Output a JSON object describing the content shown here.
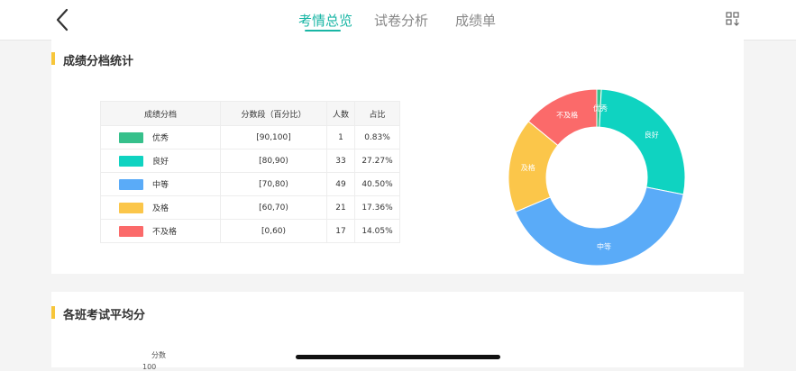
{
  "header": {
    "tabs": [
      {
        "label": "考情总览",
        "active": true
      },
      {
        "label": "试卷分析",
        "active": false
      },
      {
        "label": "成绩单",
        "active": false
      }
    ],
    "accent_color": "#19b6a5"
  },
  "grade_section": {
    "title": "成绩分档统计",
    "table": {
      "headers": [
        "成绩分档",
        "分数段（百分比）",
        "人数",
        "占比"
      ],
      "rows": [
        {
          "level": "优秀",
          "range": "[90,100]",
          "count": "1",
          "ratio": "0.83%",
          "color": "#36c08b"
        },
        {
          "level": "良好",
          "range": "[80,90)",
          "count": "33",
          "ratio": "27.27%",
          "color": "#0fd3c1"
        },
        {
          "level": "中等",
          "range": "[70,80)",
          "count": "49",
          "ratio": "40.50%",
          "color": "#5aabf8"
        },
        {
          "level": "及格",
          "range": "[60,70)",
          "count": "21",
          "ratio": "17.36%",
          "color": "#fbc64a"
        },
        {
          "level": "不及格",
          "range": "[0,60)",
          "count": "17",
          "ratio": "14.05%",
          "color": "#fb6a6a"
        }
      ]
    }
  },
  "avg_section": {
    "title": "各班考试平均分",
    "y_axis_label": "分数",
    "first_tick": "100"
  },
  "chart_data": {
    "type": "pie",
    "style": "donut",
    "categories": [
      "优秀",
      "良好",
      "中等",
      "及格",
      "不及格"
    ],
    "values": [
      1,
      33,
      49,
      21,
      17
    ],
    "colors": [
      "#36c08b",
      "#0fd3c1",
      "#5aabf8",
      "#fbc64a",
      "#fb6a6a"
    ]
  }
}
